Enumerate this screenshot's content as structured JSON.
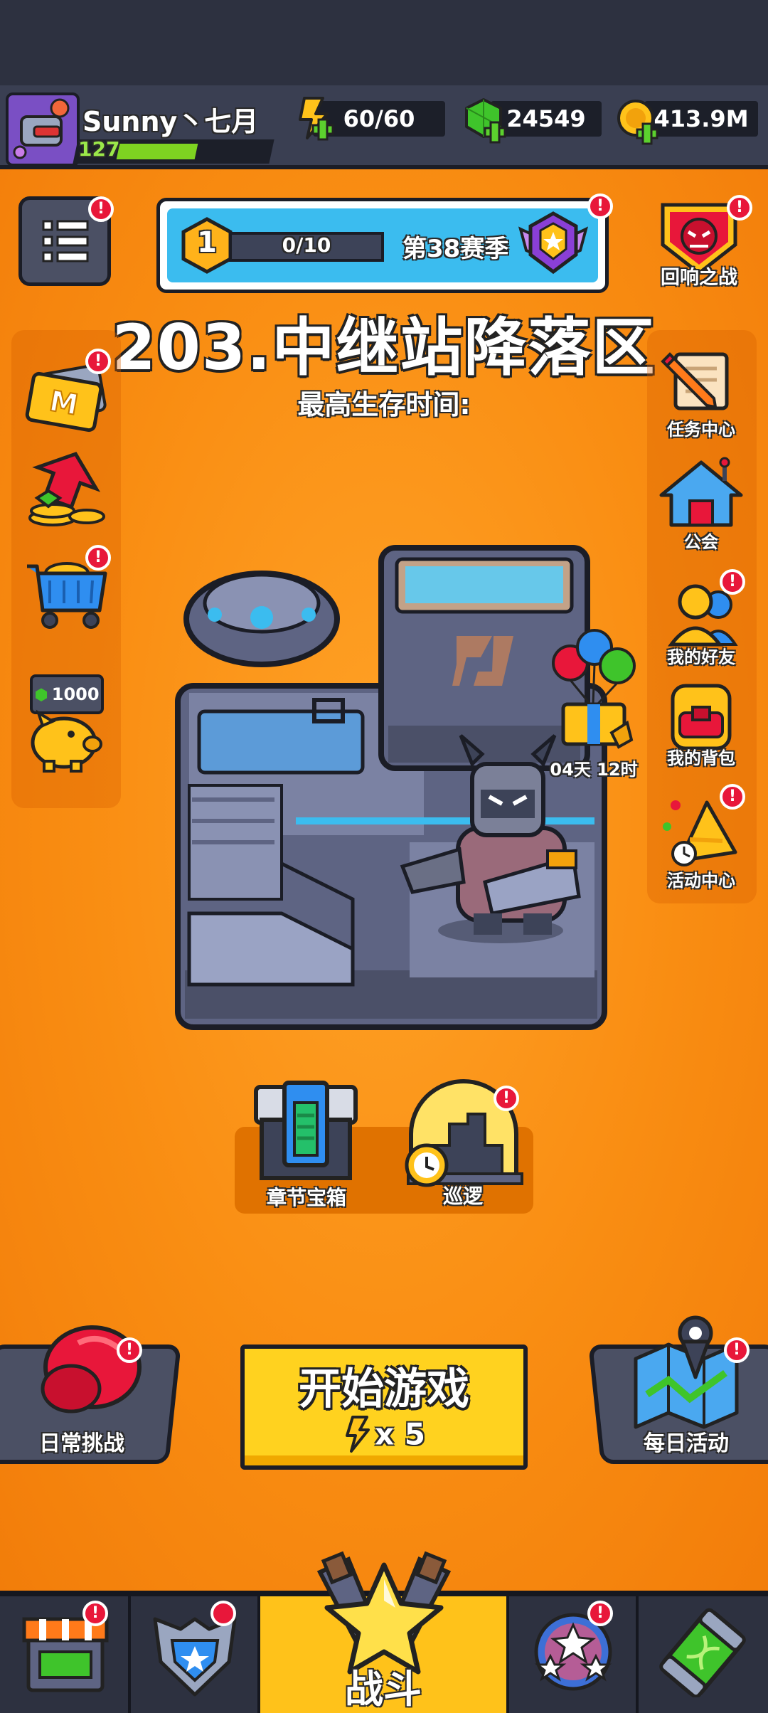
{
  "player": {
    "name": "Sunny丶七月",
    "level": "127",
    "xp_fraction": 0.55
  },
  "resources": {
    "energy": "60/60",
    "gems": "24549",
    "coins": "413.9M"
  },
  "season": {
    "rank": "1",
    "progress": "0/10",
    "progress_fraction": 0,
    "label": "第38赛季"
  },
  "echo_battle": {
    "label": "回响之战"
  },
  "stage": {
    "title": "203.中继站降落区",
    "survival_label": "最高生存时间:"
  },
  "left_menu": {
    "piggy_amount": "1000"
  },
  "right_menu": {
    "tasks": "任务中心",
    "guild": "公会",
    "friends": "我的好友",
    "bag": "我的背包",
    "events": "活动中心"
  },
  "gift": {
    "timer": "04天 12时"
  },
  "chest": {
    "chapter_label": "章节宝箱",
    "patrol_label": "巡逻"
  },
  "actions": {
    "daily_challenge": "日常挑战",
    "start_game": "开始游戏",
    "energy_cost": "x 5",
    "daily_activity": "每日活动"
  },
  "nav": {
    "battle": "战斗"
  },
  "badge_text": "!",
  "colors": {
    "background": "#f7931e",
    "header": "#3a3f52",
    "start_button": "#ffd21f",
    "alert": "#e8173a",
    "xp": "#7ed321"
  }
}
